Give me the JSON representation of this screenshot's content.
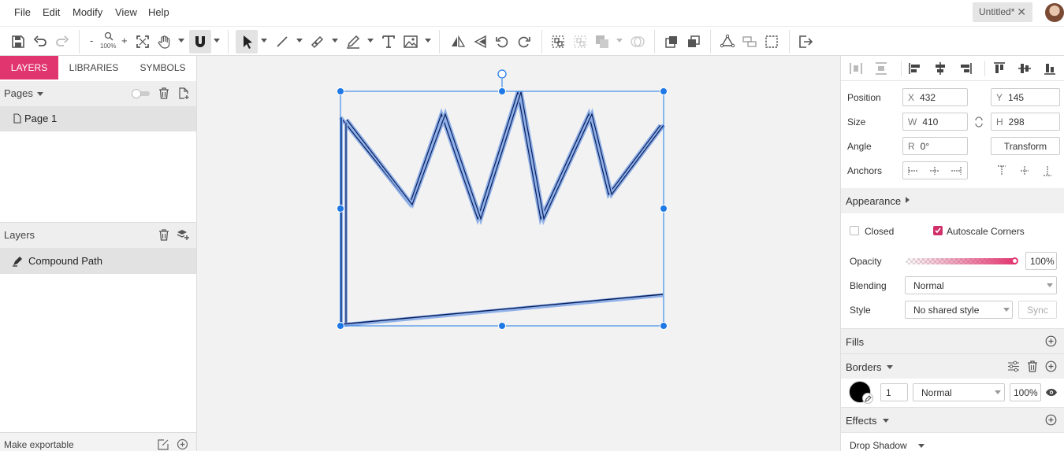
{
  "menubar": {
    "items": [
      "File",
      "Edit",
      "Modify",
      "View",
      "Help"
    ],
    "doc_tab": "Untitled*"
  },
  "toolbar": {
    "zoom_minus": "-",
    "zoom_level": "100%",
    "zoom_plus": "+"
  },
  "left_tabs": {
    "layers": "LAYERS",
    "libraries": "LIBRARIES",
    "symbols": "SYMBOLS"
  },
  "pages": {
    "header": "Pages",
    "items": [
      "Page 1"
    ]
  },
  "layers": {
    "header": "Layers",
    "items": [
      "Compound Path"
    ]
  },
  "export": {
    "label": "Make exportable"
  },
  "inspector": {
    "position_label": "Position",
    "x_prefix": "X",
    "x": "432",
    "y_prefix": "Y",
    "y": "145",
    "size_label": "Size",
    "w_prefix": "W",
    "w": "410",
    "h_prefix": "H",
    "h": "298",
    "angle_label": "Angle",
    "r_prefix": "R",
    "angle": "0°",
    "transform_button": "Transform",
    "anchors_label": "Anchors"
  },
  "appearance": {
    "header": "Appearance",
    "closed_label": "Closed",
    "closed_checked": false,
    "autoscale_label": "Autoscale Corners",
    "autoscale_checked": true,
    "opacity_label": "Opacity",
    "opacity_value": "100%",
    "opacity_level": 1.0,
    "blending_label": "Blending",
    "blending_value": "Normal",
    "style_label": "Style",
    "style_value": "No shared style",
    "sync_button": "Sync"
  },
  "fills": {
    "header": "Fills"
  },
  "borders": {
    "header": "Borders",
    "width": "1",
    "blend": "Normal",
    "opacity": "100%",
    "color": "#000000"
  },
  "effects": {
    "header": "Effects",
    "drop_shadow": "Drop Shadow"
  },
  "colors": {
    "accent": "#e0356f",
    "selection": "#1e78e6",
    "path_stroke": "#0a1f5c"
  },
  "icons": [
    "save-icon",
    "undo-icon",
    "redo-icon",
    "zoom-icon",
    "fit-icon",
    "hand-icon",
    "magnet-icon",
    "pointer-icon",
    "line-icon",
    "pen-icon",
    "pencil-icon",
    "text-icon",
    "image-icon",
    "flip-horizontal-icon",
    "flip-vertical-icon",
    "rotate-left-icon",
    "rotate-right-icon",
    "group-icon",
    "ungroup-icon",
    "boolean-icon",
    "mask-icon",
    "bring-forward-icon",
    "send-backward-icon",
    "path-icon",
    "component-icon",
    "frame-icon",
    "export-icon"
  ]
}
